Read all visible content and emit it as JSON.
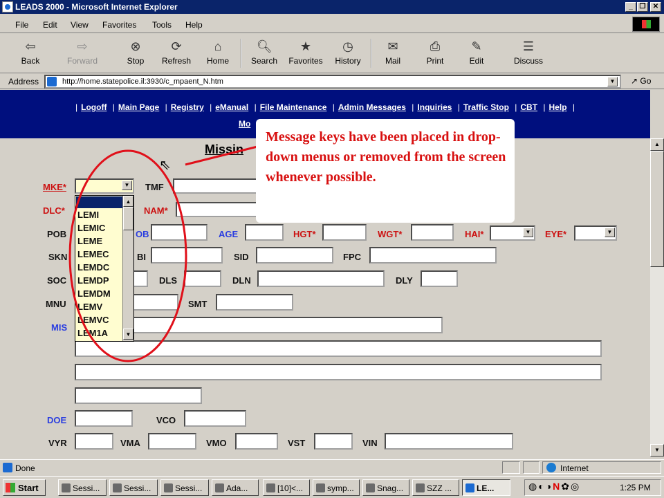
{
  "window": {
    "title": "LEADS 2000 - Microsoft Internet Explorer"
  },
  "menu": [
    "File",
    "Edit",
    "View",
    "Favorites",
    "Tools",
    "Help"
  ],
  "toolbar": {
    "back": "Back",
    "forward": "Forward",
    "stop": "Stop",
    "refresh": "Refresh",
    "home": "Home",
    "search": "Search",
    "favorites": "Favorites",
    "history": "History",
    "mail": "Mail",
    "print": "Print",
    "edit": "Edit",
    "discuss": "Discuss"
  },
  "address": {
    "label": "Address",
    "url": "http://home.statepolice.il:3930/c_mpaent_N.htm",
    "go": "Go"
  },
  "nav": {
    "links": [
      "Logoff",
      "Main Page",
      "Registry",
      "eManual",
      "File Maintenance",
      "Admin Messages",
      "Inquiries",
      "Traffic Stop",
      "CBT",
      "Help"
    ],
    "line2": "Mo"
  },
  "form": {
    "title": "Missin",
    "labels": {
      "mke": "MKE*",
      "tmf": "TMF",
      "dlc": "DLC*",
      "nam": "NAM*",
      "pob": "POB",
      "dob": "OB",
      "age": "AGE",
      "hgt": "HGT*",
      "wgt": "WGT*",
      "hai": "HAI*",
      "eye": "EYE*",
      "skn": "SKN",
      "fbi": "BI",
      "sid": "SID",
      "fpc": "FPC",
      "soc": "SOC",
      "dls": "DLS",
      "dln": "DLN",
      "dly": "DLY",
      "mnu": "MNU",
      "smt": "SMT",
      "mis": "MIS",
      "doe": "DOE",
      "vco": "VCO",
      "vyr": "VYR",
      "vma": "VMA",
      "vmo": "VMO",
      "vst": "VST",
      "vin": "VIN"
    },
    "mke_options": [
      "LEMI",
      "LEMIC",
      "LEME",
      "LEMEC",
      "LEMDC",
      "LEMDP",
      "LEMDM",
      "LEMV",
      "LEMVC",
      "LEM1A"
    ]
  },
  "callout": "Message keys have been placed in drop-down menus or removed from the screen whenever possible.",
  "status": {
    "text": "Done",
    "zone": "Internet"
  },
  "taskbar": {
    "start": "Start",
    "items": [
      "Sessi...",
      "Sessi...",
      "Sessi...",
      "Ada...",
      "[10]<...",
      "symp...",
      "Snag...",
      "SZZ ...",
      "LE..."
    ],
    "clock": "1:25 PM"
  },
  "colors": {
    "navbar": "#000f7e",
    "titlebar": "#0a246a",
    "required": "#cc1111",
    "optional": "#2a3de0",
    "callout_text": "#d81010",
    "highlight_ring": "#e0101a"
  }
}
